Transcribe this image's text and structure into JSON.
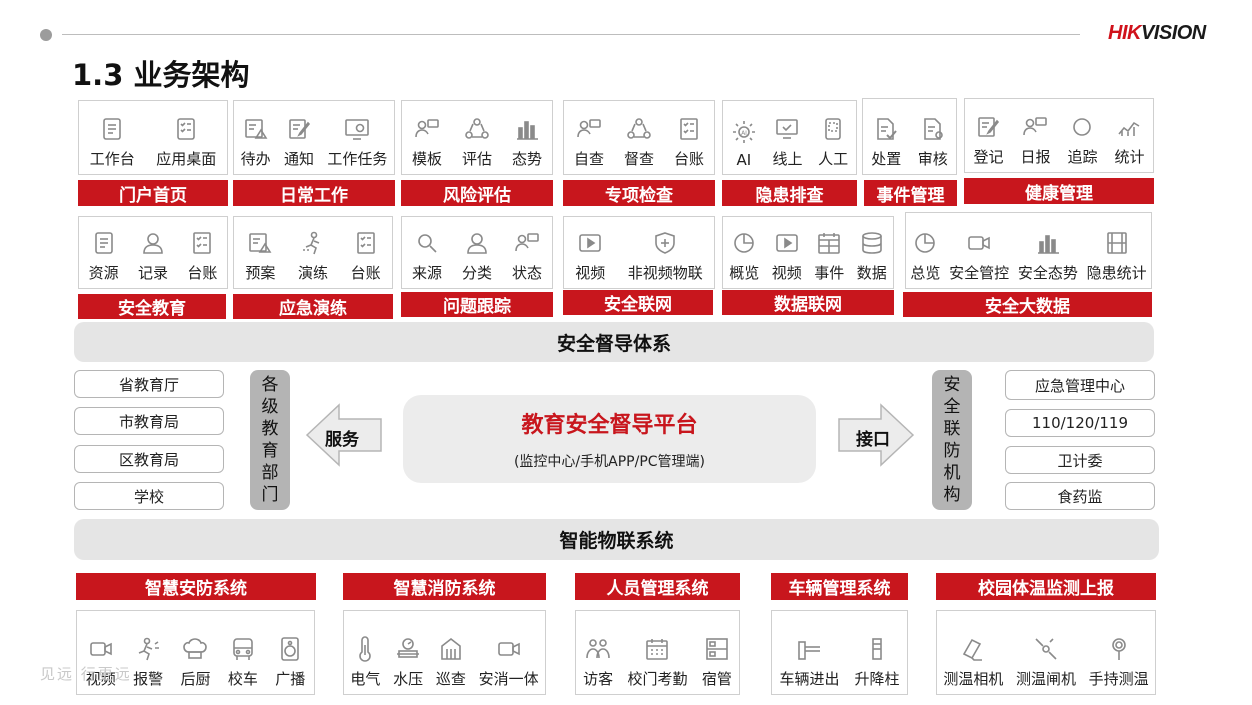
{
  "header": {
    "logo_red": "HIK",
    "logo_dark": "VISION",
    "title": "1.3 业务架构"
  },
  "row1": [
    {
      "label": "门户首页",
      "items": [
        {
          "icon": "workbench-icon",
          "label": "工作台"
        },
        {
          "icon": "app-desktop-icon",
          "label": "应用桌面"
        }
      ]
    },
    {
      "label": "日常工作",
      "items": [
        {
          "icon": "todo-icon",
          "label": "待办"
        },
        {
          "icon": "notice-icon",
          "label": "通知"
        },
        {
          "icon": "task-icon",
          "label": "工作任务"
        }
      ]
    },
    {
      "label": "风险评估",
      "items": [
        {
          "icon": "template-icon",
          "label": "模板"
        },
        {
          "icon": "evaluate-icon",
          "label": "评估"
        },
        {
          "icon": "trend-icon",
          "label": "态势"
        }
      ]
    },
    {
      "label": "专项检查",
      "items": [
        {
          "icon": "self-check-icon",
          "label": "自查"
        },
        {
          "icon": "supervise-icon",
          "label": "督查"
        },
        {
          "icon": "ledger-icon",
          "label": "台账"
        }
      ]
    },
    {
      "label": "隐患排查",
      "items": [
        {
          "icon": "ai-icon",
          "label": "AI"
        },
        {
          "icon": "online-icon",
          "label": "线上"
        },
        {
          "icon": "manual-icon",
          "label": "人工"
        }
      ]
    },
    {
      "label": "事件管理",
      "items": [
        {
          "icon": "handle-icon",
          "label": "处置"
        },
        {
          "icon": "review-icon",
          "label": "审核"
        }
      ]
    },
    {
      "label": "健康管理",
      "items": [
        {
          "icon": "register-icon",
          "label": "登记"
        },
        {
          "icon": "daily-report-icon",
          "label": "日报"
        },
        {
          "icon": "trace-icon",
          "label": "追踪"
        },
        {
          "icon": "statistics-icon",
          "label": "统计"
        }
      ]
    }
  ],
  "row2": [
    {
      "label": "安全教育",
      "items": [
        {
          "icon": "resource-icon",
          "label": "资源"
        },
        {
          "icon": "record-icon",
          "label": "记录"
        },
        {
          "icon": "ledger-icon",
          "label": "台账"
        }
      ]
    },
    {
      "label": "应急演练",
      "items": [
        {
          "icon": "plan-icon",
          "label": "预案"
        },
        {
          "icon": "drill-icon",
          "label": "演练"
        },
        {
          "icon": "ledger-icon",
          "label": "台账"
        }
      ]
    },
    {
      "label": "问题跟踪",
      "items": [
        {
          "icon": "source-icon",
          "label": "来源"
        },
        {
          "icon": "category-icon",
          "label": "分类"
        },
        {
          "icon": "status-icon",
          "label": "状态"
        }
      ]
    },
    {
      "label": "安全联网",
      "items": [
        {
          "icon": "video-icon",
          "label": "视频"
        },
        {
          "icon": "iot-icon",
          "label": "非视频物联"
        }
      ]
    },
    {
      "label": "数据联网",
      "items": [
        {
          "icon": "overview-icon",
          "label": "概览"
        },
        {
          "icon": "video-icon",
          "label": "视频"
        },
        {
          "icon": "event-icon",
          "label": "事件"
        },
        {
          "icon": "data-icon",
          "label": "数据"
        }
      ]
    },
    {
      "label": "安全大数据",
      "items": [
        {
          "icon": "overview-icon",
          "label": "总览"
        },
        {
          "icon": "camera-icon",
          "label": "安全管控"
        },
        {
          "icon": "trend-icon",
          "label": "安全态势"
        },
        {
          "icon": "film-icon",
          "label": "隐患统计"
        }
      ]
    }
  ],
  "supervision_bar": "安全督导体系",
  "left_units": [
    "省教育厅",
    "市教育局",
    "区教育局",
    "学校"
  ],
  "left_group": "各级教育部门",
  "service_label": "服务",
  "platform": {
    "title": "教育安全督导平台",
    "subtitle": "(监控中心/手机APP/PC管理端)"
  },
  "interface_label": "接口",
  "right_group": "安全联防机构",
  "right_units": [
    "应急管理中心",
    "110/120/119",
    "卫计委",
    "食药监"
  ],
  "iot_bar": "智能物联系统",
  "row3": [
    {
      "label": "智慧安防系统",
      "items": [
        {
          "icon": "camera-icon",
          "label": "视频"
        },
        {
          "icon": "alarm-icon",
          "label": "报警"
        },
        {
          "icon": "chef-icon",
          "label": "后厨"
        },
        {
          "icon": "bus-icon",
          "label": "校车"
        },
        {
          "icon": "speaker-icon",
          "label": "广播"
        }
      ]
    },
    {
      "label": "智慧消防系统",
      "items": [
        {
          "icon": "thermometer-icon",
          "label": "电气"
        },
        {
          "icon": "pressure-icon",
          "label": "水压"
        },
        {
          "icon": "patrol-icon",
          "label": "巡查"
        },
        {
          "icon": "camera-icon",
          "label": "安消一体"
        }
      ]
    },
    {
      "label": "人员管理系统",
      "items": [
        {
          "icon": "visitor-icon",
          "label": "访客"
        },
        {
          "icon": "calendar-icon",
          "label": "校门考勤"
        },
        {
          "icon": "dorm-icon",
          "label": "宿管"
        }
      ]
    },
    {
      "label": "车辆管理系统",
      "items": [
        {
          "icon": "gate-icon",
          "label": "车辆进出"
        },
        {
          "icon": "bollard-icon",
          "label": "升降柱"
        }
      ]
    },
    {
      "label": "校园体温监测上报",
      "items": [
        {
          "icon": "thermal-camera-icon",
          "label": "测温相机"
        },
        {
          "icon": "turnstile-icon",
          "label": "测温闸机"
        },
        {
          "icon": "handheld-icon",
          "label": "手持测温"
        }
      ]
    }
  ],
  "watermark": "见远 行更远"
}
